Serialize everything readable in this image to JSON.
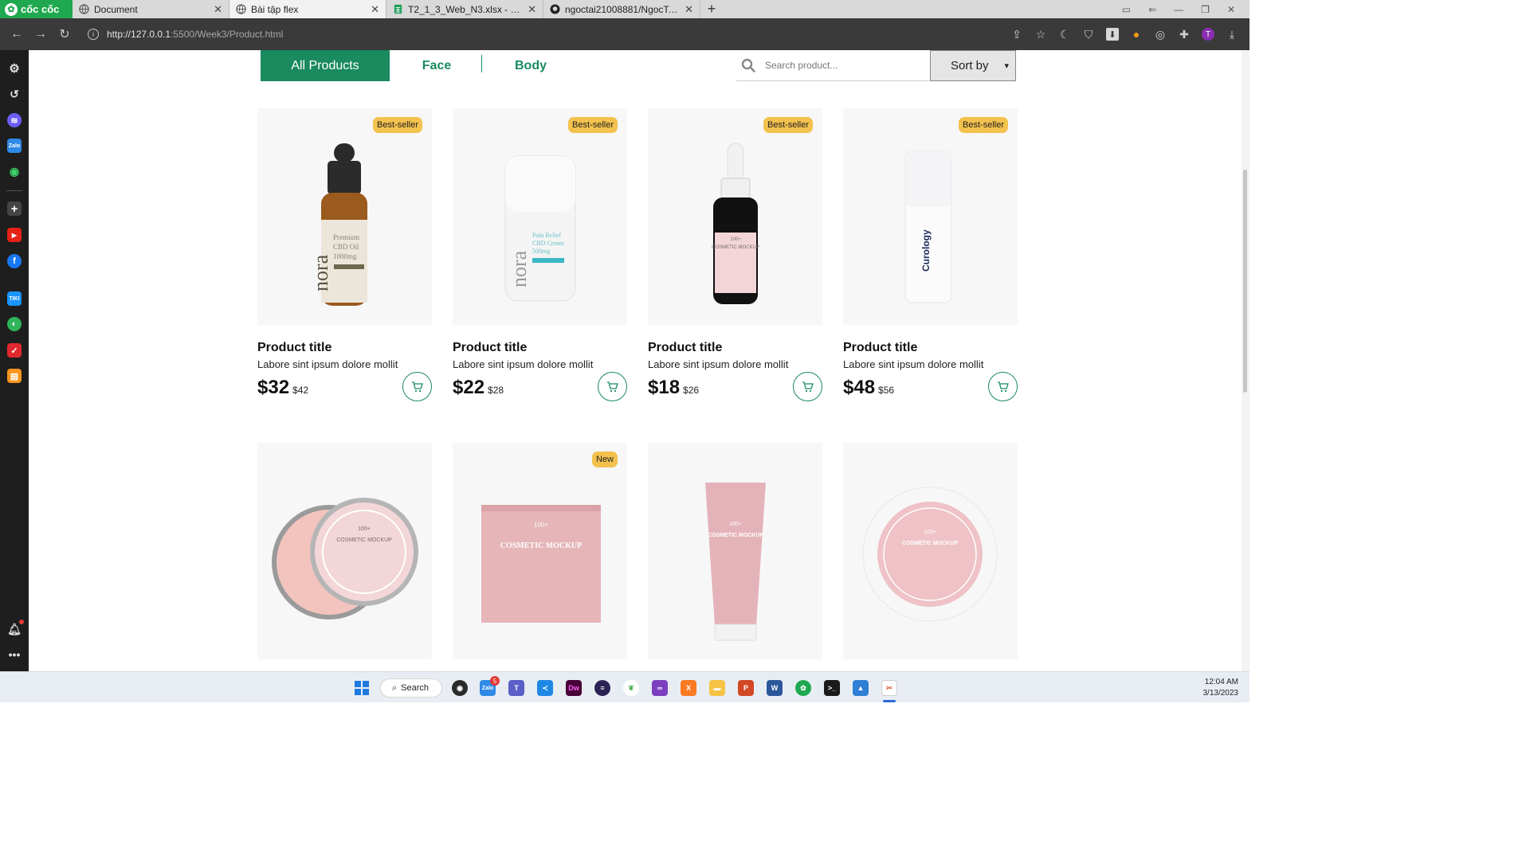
{
  "browser": {
    "brand": "cốc cốc",
    "tabs": [
      {
        "label": "Document",
        "active": false,
        "icon": "globe-icon"
      },
      {
        "label": "Bài tập flex",
        "active": true,
        "icon": "globe-icon"
      },
      {
        "label": "T2_1_3_Web_N3.xlsx - Google Sheets",
        "active": false,
        "icon": "sheets-icon"
      },
      {
        "label": "ngoctai21008881/NgocTai-2",
        "active": false,
        "icon": "github-icon"
      }
    ],
    "url_host": "http://127.0.0.1",
    "url_rest": ":5500/Week3/Product.html",
    "profile_initial": "T"
  },
  "filters": {
    "tabs": [
      "All Products",
      "Face",
      "Body"
    ],
    "search_placeholder": "Search product...",
    "sort_label": "Sort by"
  },
  "products": [
    {
      "badge": "Best-seller",
      "title": "Product title",
      "desc": "Labore sint ipsum dolore mollit",
      "price": "$32",
      "old_price": "$42",
      "label_text": "nora",
      "label_sub": "Premium CBD Oil 1000mg"
    },
    {
      "badge": "Best-seller",
      "title": "Product title",
      "desc": "Labore sint ipsum dolore mollit",
      "price": "$22",
      "old_price": "$28",
      "label_text": "nora",
      "label_sub": "Pain Relief CBD Cream 500mg"
    },
    {
      "badge": "Best-seller",
      "title": "Product title",
      "desc": "Labore sint ipsum dolore mollit",
      "price": "$18",
      "old_price": "$26",
      "label_text": "100+",
      "label_sub": "COSMETIC MOCKUP"
    },
    {
      "badge": "Best-seller",
      "title": "Product title",
      "desc": "Labore sint ipsum dolore mollit",
      "price": "$48",
      "old_price": "$56",
      "label_text": "Curology",
      "label_sub": ""
    },
    {
      "badge": "",
      "label_text": "100+",
      "label_sub": "COSMETIC MOCKUP"
    },
    {
      "badge": "New",
      "label_text": "100+",
      "label_sub": "COSMETIC MOCKUP"
    },
    {
      "badge": "",
      "label_text": "100+",
      "label_sub": "COSMETIC MOCKUP"
    },
    {
      "badge": "",
      "label_text": "100+",
      "label_sub": "COSMETIC MOCKUP"
    }
  ],
  "taskbar": {
    "search_label": "Search",
    "zalo_badge": "5",
    "time": "12:04 AM",
    "date": "3/13/2023"
  },
  "colors": {
    "accent": "#1a8a5f",
    "badge": "#f3c14d",
    "brand": "#1fa84f"
  }
}
